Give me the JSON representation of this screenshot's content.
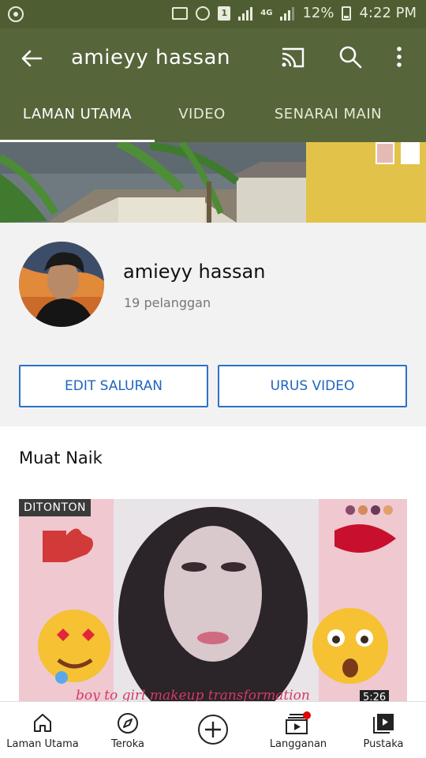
{
  "status_bar": {
    "signal_label": "4G",
    "sim_label": "1",
    "battery": "12%",
    "time": "4:22 PM"
  },
  "app_bar": {
    "title": "amieyy hassan",
    "tabs": [
      {
        "label": "LAMAN UTAMA",
        "selected": true
      },
      {
        "label": "VIDEO",
        "selected": false
      },
      {
        "label": "SENARAI MAIN",
        "selected": false
      }
    ]
  },
  "channel": {
    "name": "amieyy hassan",
    "subscribers": "19 pelanggan",
    "edit_button": "EDIT SALURAN",
    "manage_button": "URUS VIDEO"
  },
  "uploads": {
    "title": "Muat Naik",
    "video": {
      "watched_badge": "DITONTON",
      "duration": "5:26",
      "overlay_caption": "boy to girl makeup transformation"
    }
  },
  "bottom_nav": {
    "items": [
      {
        "label": "Laman Utama",
        "icon": "home-icon"
      },
      {
        "label": "Teroka",
        "icon": "compass-icon"
      },
      {
        "label": "",
        "icon": "add-icon"
      },
      {
        "label": "Langganan",
        "icon": "subscriptions-icon"
      },
      {
        "label": "Pustaka",
        "icon": "library-icon"
      }
    ]
  },
  "colors": {
    "app_bar": "#56653a",
    "status_bar": "#4f5e32",
    "button_blue": "#1f65bd",
    "notification_dot": "#e00000"
  }
}
